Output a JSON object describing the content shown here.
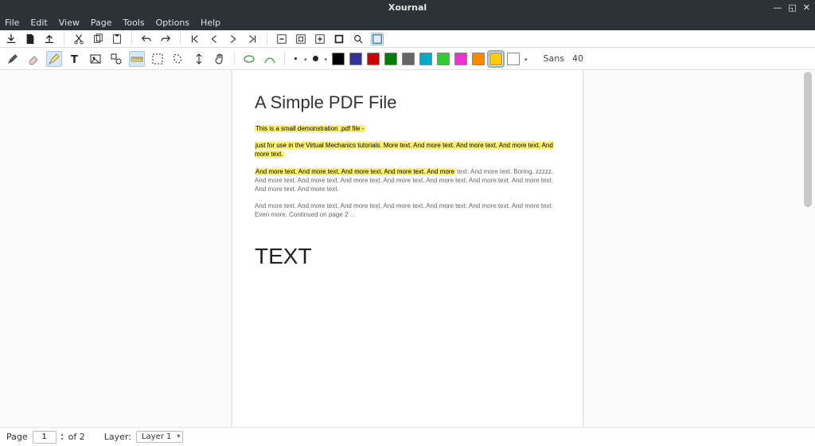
{
  "app": {
    "title": "Xournal"
  },
  "menubar": {
    "items": [
      "File",
      "Edit",
      "View",
      "Page",
      "Tools",
      "Options",
      "Help"
    ]
  },
  "font": {
    "family": "Sans",
    "size": "40"
  },
  "colors": {
    "palette": [
      "#000000",
      "#333399",
      "#cc0000",
      "#008000",
      "#666666",
      "#00aacc",
      "#33cc33",
      "#ee33cc",
      "#ff8800",
      "#ffcc00",
      "#ffffff"
    ],
    "selected_index": 9
  },
  "document": {
    "heading": "A Simple PDF File",
    "p1_hl": "This is a small demonstration .pdf file -",
    "p2_hl": "just for use in the Virtual Mechanics tutorials. More text. And more text. And more text. And more text. And more text.",
    "p3_hl": "And more text. And more text. And more text. And more text. And more",
    "p3_rest": " text. And more text. Boring, zzzzz. And more text. And more text. And more text. And more text. And more text. And more text. And more text. And more text. And more text.",
    "p4": "And more text. And more text. And more text. And more text. And more text. And more text. And more text. Even more. Continued on page 2 ...",
    "annotation_text": "TEXT"
  },
  "status": {
    "page_label": "Page",
    "current_page": "1",
    "total_pages": "of 2",
    "layer_label": "Layer:",
    "layer_value": "Layer 1"
  }
}
